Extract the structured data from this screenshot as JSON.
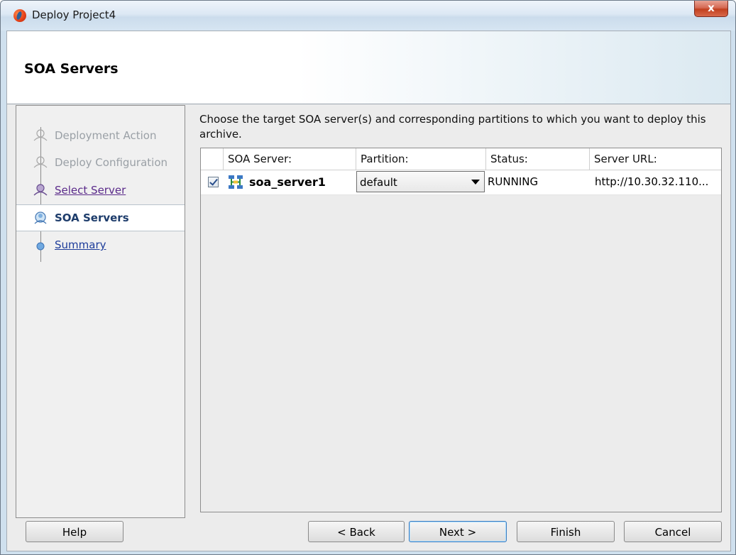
{
  "window": {
    "title": "Deploy Project4",
    "close_label": "x"
  },
  "header": {
    "title": "SOA Servers"
  },
  "nav": {
    "items": [
      {
        "label": "Deployment Action",
        "state": "disabled"
      },
      {
        "label": "Deploy Configuration",
        "state": "disabled"
      },
      {
        "label": "Select Server",
        "state": "link"
      },
      {
        "label": "SOA Servers",
        "state": "current"
      },
      {
        "label": "Summary",
        "state": "link"
      }
    ]
  },
  "content": {
    "instructions": "Choose the target SOA server(s) and corresponding partitions to which you want to deploy this archive.",
    "table": {
      "headers": [
        "",
        "SOA Server:",
        "Partition:",
        "Status:",
        "Server URL:"
      ],
      "rows": [
        {
          "checked": true,
          "server": "soa_server1",
          "partition": "default",
          "status": "RUNNING",
          "url": "http://10.30.32.110..."
        }
      ]
    }
  },
  "footer": {
    "help": "Help",
    "back": "< Back",
    "next": "Next >",
    "finish": "Finish",
    "cancel": "Cancel"
  },
  "colors": {
    "header_gradient_end": "#dbe9f1",
    "link": "#5a2a8a",
    "current": "#1d3c6b",
    "default_button_border": "#3d7bbf"
  },
  "icons": [
    "app-logo-icon",
    "close-icon",
    "train-stop-icon",
    "server-cluster-icon",
    "dropdown-caret-icon",
    "checkbox-checked-icon"
  ]
}
